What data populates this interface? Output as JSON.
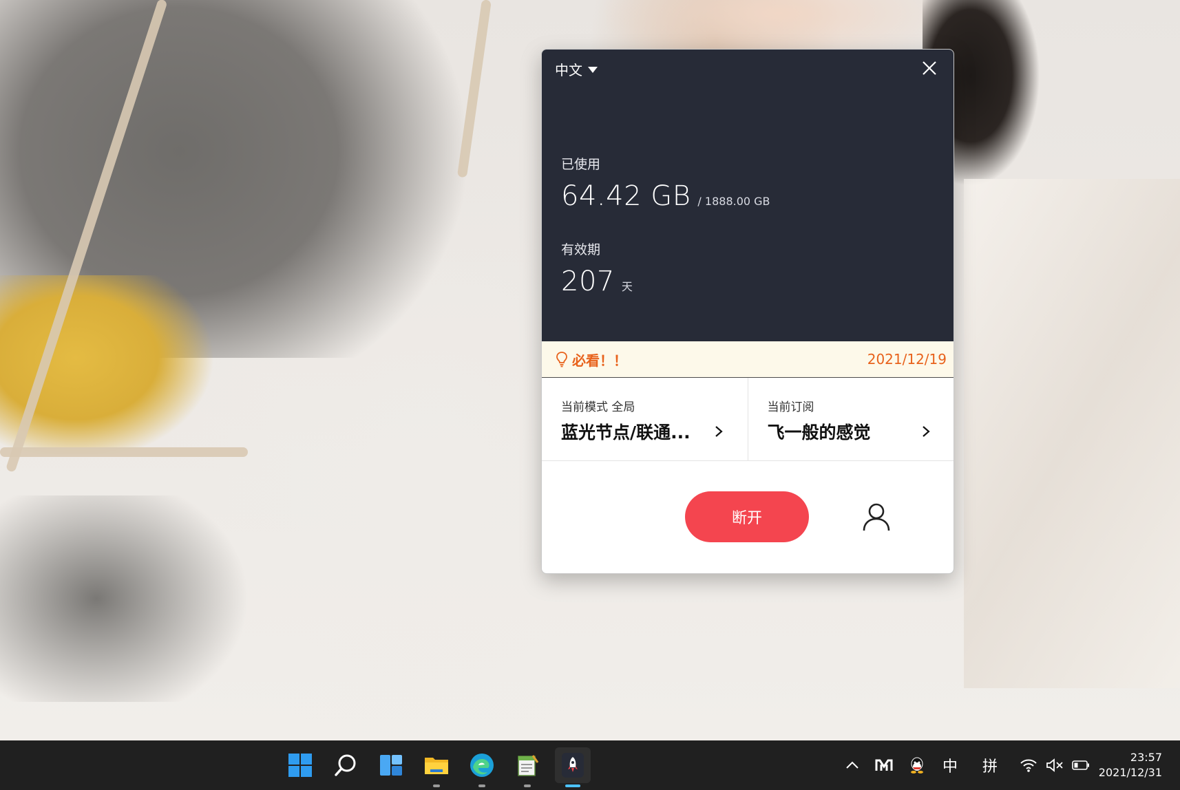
{
  "app": {
    "language": "中文",
    "usage": {
      "label": "已使用",
      "used": "64.42 GB",
      "total": "/ 1888.00 GB"
    },
    "validity": {
      "label": "有效期",
      "days": "207",
      "unit": "天"
    },
    "notice": {
      "text": "必看！！",
      "date": "2021/12/19"
    },
    "mode": {
      "label": "当前模式 全局",
      "value": "蓝光节点/联通..."
    },
    "subscription": {
      "label": "当前订阅",
      "value": "飞一般的感觉"
    },
    "disconnect_label": "断开",
    "colors": {
      "header_bg": "#272b37",
      "accent": "#f4454f",
      "notice_text": "#e8621c",
      "notice_bg": "#fdf9ea"
    }
  },
  "taskbar": {
    "apps": [
      {
        "name": "start-icon"
      },
      {
        "name": "search-icon"
      },
      {
        "name": "widgets-icon"
      },
      {
        "name": "file-explorer-icon"
      },
      {
        "name": "edge-icon"
      },
      {
        "name": "notepad-icon"
      },
      {
        "name": "rocket-app-icon",
        "active": true
      }
    ],
    "tray": {
      "ime_mode": "中",
      "ime_type": "拼"
    },
    "clock": {
      "time": "23:57",
      "date": "2021/12/31"
    }
  }
}
